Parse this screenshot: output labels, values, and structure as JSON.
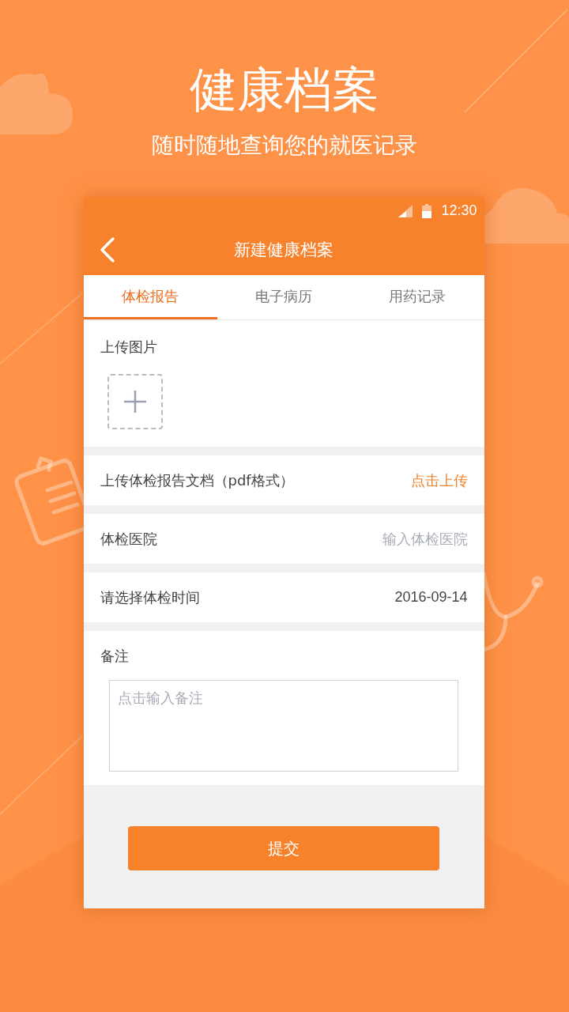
{
  "headline": "健康档案",
  "subtitle": "随时随地查询您的就医记录",
  "status_bar": {
    "time": "12:30"
  },
  "nav": {
    "title": "新建健康档案"
  },
  "tabs": [
    {
      "label": "体检报告",
      "selected": true
    },
    {
      "label": "电子病历",
      "selected": false
    },
    {
      "label": "用药记录",
      "selected": false
    }
  ],
  "upload": {
    "label": "上传图片"
  },
  "rows": [
    {
      "kind": "action",
      "label": "上传体检报告文档（pdf格式）",
      "action": "点击上传"
    },
    {
      "kind": "input",
      "label": "体检医院",
      "placeholder": "输入体检医院"
    },
    {
      "kind": "value",
      "label": "请选择体检时间",
      "value": "2016-09-14"
    }
  ],
  "remark": {
    "label": "备注",
    "placeholder": "点击输入备注"
  },
  "submit": "提交"
}
